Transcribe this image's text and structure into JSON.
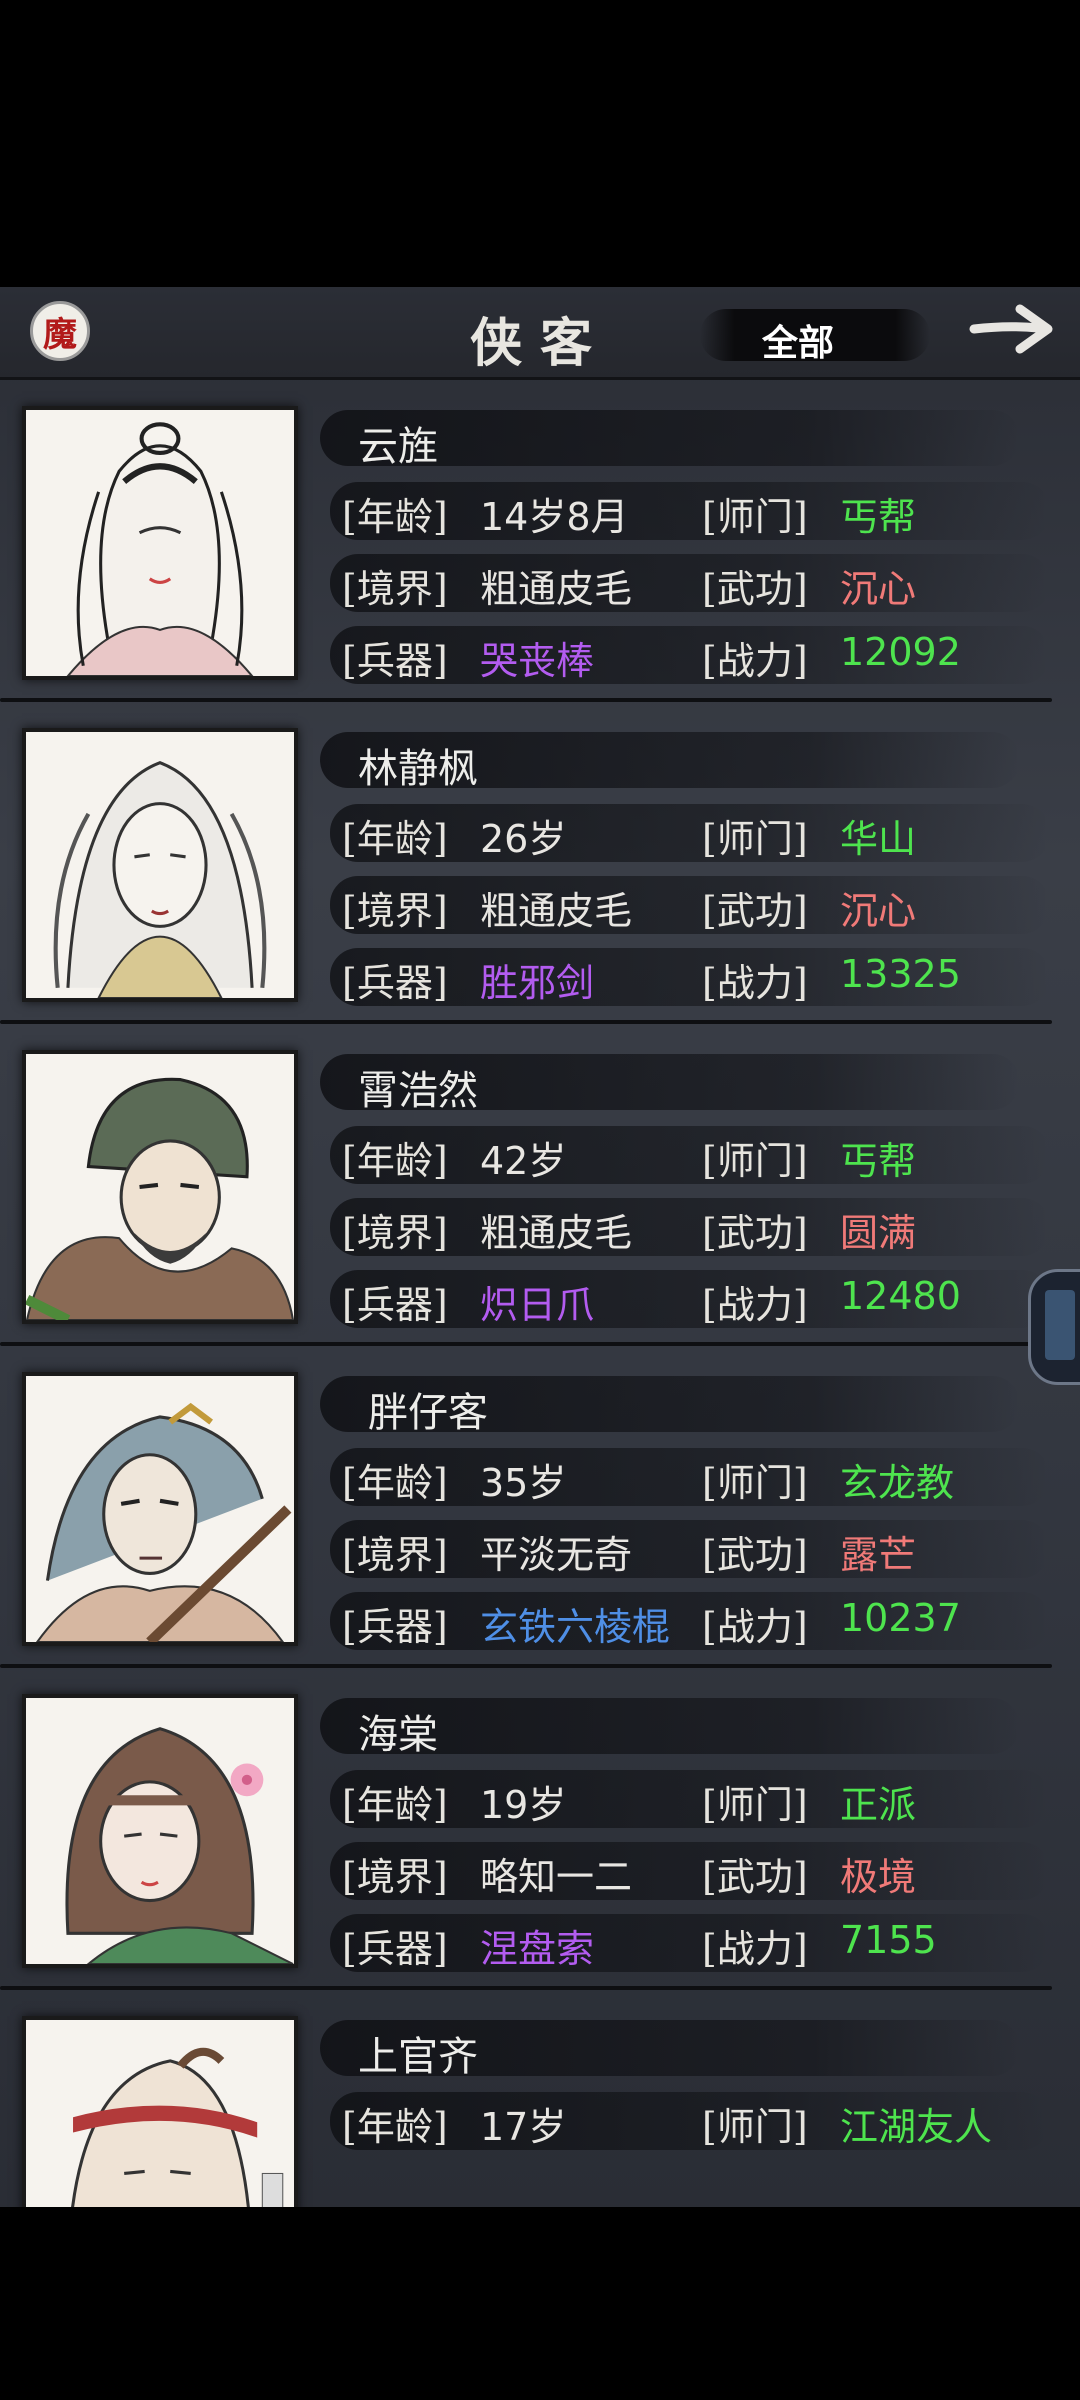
{
  "header": {
    "logo_char": "魔",
    "title": "侠客",
    "filter_label": "全部"
  },
  "labels": {
    "age": "[年龄]",
    "sect": "[师门]",
    "realm": "[境界]",
    "skill": "[武功]",
    "weapon": "[兵器]",
    "power": "[战力]"
  },
  "heroes": [
    {
      "name": "云旌",
      "age": "14岁8月",
      "sect": "丐帮",
      "realm": "粗通皮毛",
      "skill": "沉心",
      "weapon": "哭丧棒",
      "power": "12092"
    },
    {
      "name": "林静枫",
      "age": "26岁",
      "sect": "华山",
      "realm": "粗通皮毛",
      "skill": "沉心",
      "weapon": "胜邪剑",
      "power": "13325"
    },
    {
      "name": "霄浩然",
      "age": "42岁",
      "sect": "丐帮",
      "realm": "粗通皮毛",
      "skill": "圆满",
      "weapon": "炽日爪",
      "power": "12480"
    },
    {
      "name": "胖仔客",
      "age": "35岁",
      "sect": "玄龙教",
      "realm": "平淡无奇",
      "skill": "露芒",
      "weapon": "玄铁六棱棍",
      "power": "10237"
    },
    {
      "name": "海棠",
      "age": "19岁",
      "sect": "正派",
      "realm": "略知一二",
      "skill": "极境",
      "weapon": "涅盘索",
      "power": "7155"
    },
    {
      "name": "上官齐",
      "age": "17岁",
      "sect": "江湖友人",
      "realm": "",
      "skill": "",
      "weapon": "",
      "power": ""
    }
  ],
  "colors": {
    "green": "#4ee44e",
    "red": "#f07a78",
    "purple": "#b35cf0",
    "blue": "#4f8fe6"
  }
}
